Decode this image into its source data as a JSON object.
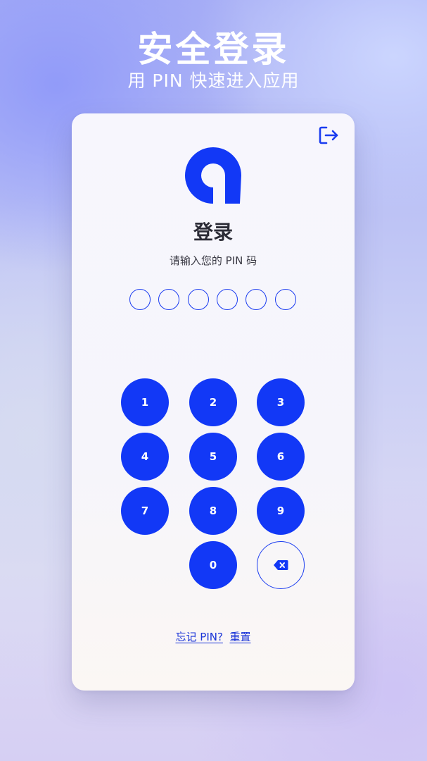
{
  "hero": {
    "title": "安全登录",
    "subtitle": "用 PIN 快速进入应用"
  },
  "card": {
    "logout_icon": "logout-icon",
    "logo_icon": "app-logo",
    "title": "登录",
    "prompt": "请输入您的 PIN 码",
    "pin_length": 6,
    "pin_filled": 0,
    "keypad": {
      "keys": [
        "1",
        "2",
        "3",
        "4",
        "5",
        "6",
        "7",
        "8",
        "9",
        "0"
      ],
      "delete_icon": "backspace-icon"
    },
    "forgot_link": {
      "question": "忘记 PIN?",
      "action": "重置"
    }
  },
  "colors": {
    "accent": "#1238f6",
    "title_text": "#2b2b35",
    "link": "#1a34d8"
  }
}
